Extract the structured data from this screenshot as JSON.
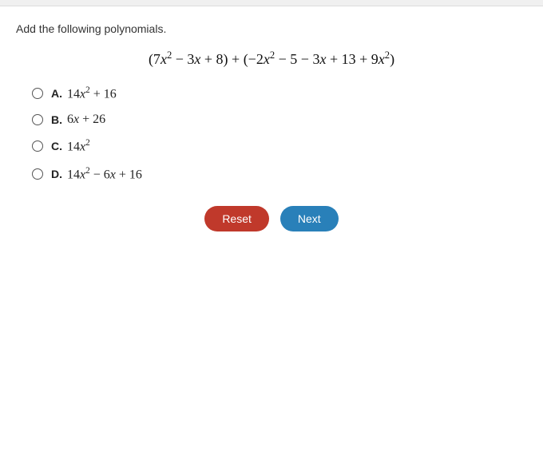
{
  "page": {
    "instruction": "Add the following polynomials.",
    "equation": "(7x² − 3x + 8) + (−2x² − 5 − 3x + 13 + 9x²)",
    "options": [
      {
        "id": "A",
        "text": "14x² + 16"
      },
      {
        "id": "B",
        "text": "6x + 26"
      },
      {
        "id": "C",
        "text": "14x²"
      },
      {
        "id": "D",
        "text": "14x² − 6x + 16"
      }
    ],
    "buttons": {
      "reset": "Reset",
      "next": "Next"
    }
  }
}
